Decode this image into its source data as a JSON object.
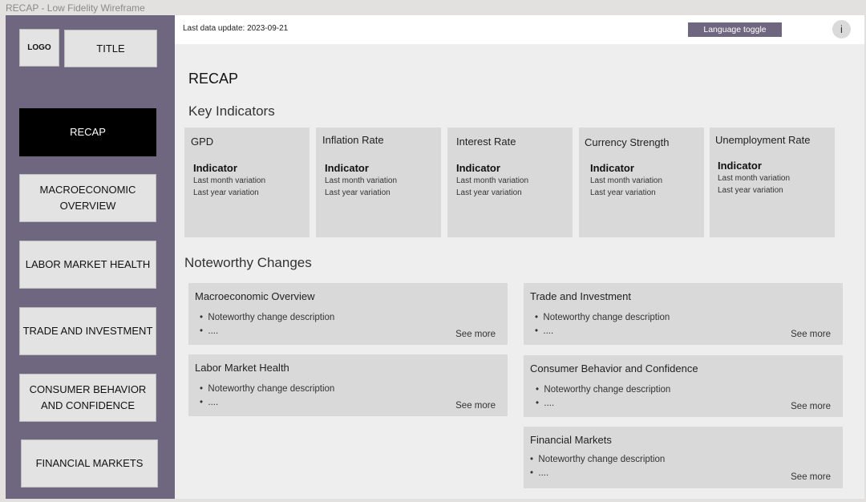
{
  "window": {
    "title": "RECAP - Low Fidelity Wireframe"
  },
  "sidebar": {
    "logo": "LOGO",
    "title": "TITLE",
    "items": [
      {
        "label": "RECAP"
      },
      {
        "label": "MACROECONOMIC OVERVIEW"
      },
      {
        "label": "LABOR MARKET HEALTH"
      },
      {
        "label": "TRADE AND INVESTMENT"
      },
      {
        "label": "CONSUMER BEHAVIOR AND CONFIDENCE"
      },
      {
        "label": "FINANCIAL MARKETS"
      }
    ],
    "active_item": "RECAP"
  },
  "topbar": {
    "last_update": "Last data update: 2023-09-21",
    "language_toggle": "Language toggle",
    "info": "i"
  },
  "main": {
    "page_title": "RECAP",
    "key_indicators_title": "Key Indicators",
    "indicators": [
      {
        "name": "GPD",
        "value": "Indicator",
        "month": "Last month variation",
        "year": "Last year variation"
      },
      {
        "name": "Inflation Rate",
        "value": "Indicator",
        "month": "Last month variation",
        "year": "Last year variation"
      },
      {
        "name": "Interest Rate",
        "value": "Indicator",
        "month": "Last month variation",
        "year": "Last year variation"
      },
      {
        "name": "Currency Strength",
        "value": "Indicator",
        "month": "Last month variation",
        "year": "Last year variation"
      },
      {
        "name": "Unemployment Rate",
        "value": "Indicator",
        "month": "Last month variation",
        "year": "Last year variation"
      }
    ],
    "noteworthy_title": "Noteworthy Changes",
    "changes": [
      {
        "title": "Macroeconomic Overview",
        "bullet1": "Noteworthy change description",
        "bullet2": "....",
        "more": "See more"
      },
      {
        "title": "Trade and Investment",
        "bullet1": "Noteworthy change description",
        "bullet2": "....",
        "more": "See more"
      },
      {
        "title": "Labor Market Health",
        "bullet1": "Noteworthy change description",
        "bullet2": "....",
        "more": "See more"
      },
      {
        "title": "Consumer Behavior and Confidence",
        "bullet1": "Noteworthy change description",
        "bullet2": "....",
        "more": "See more"
      },
      {
        "title": "Financial Markets",
        "bullet1": "Noteworthy change description",
        "bullet2": "....",
        "more": "See more"
      }
    ]
  },
  "colors": {
    "sidebar_bg": "#6f6780",
    "active_nav": "#000000",
    "card_bg": "#d9d9d9",
    "content_bg": "#eeeeee"
  }
}
